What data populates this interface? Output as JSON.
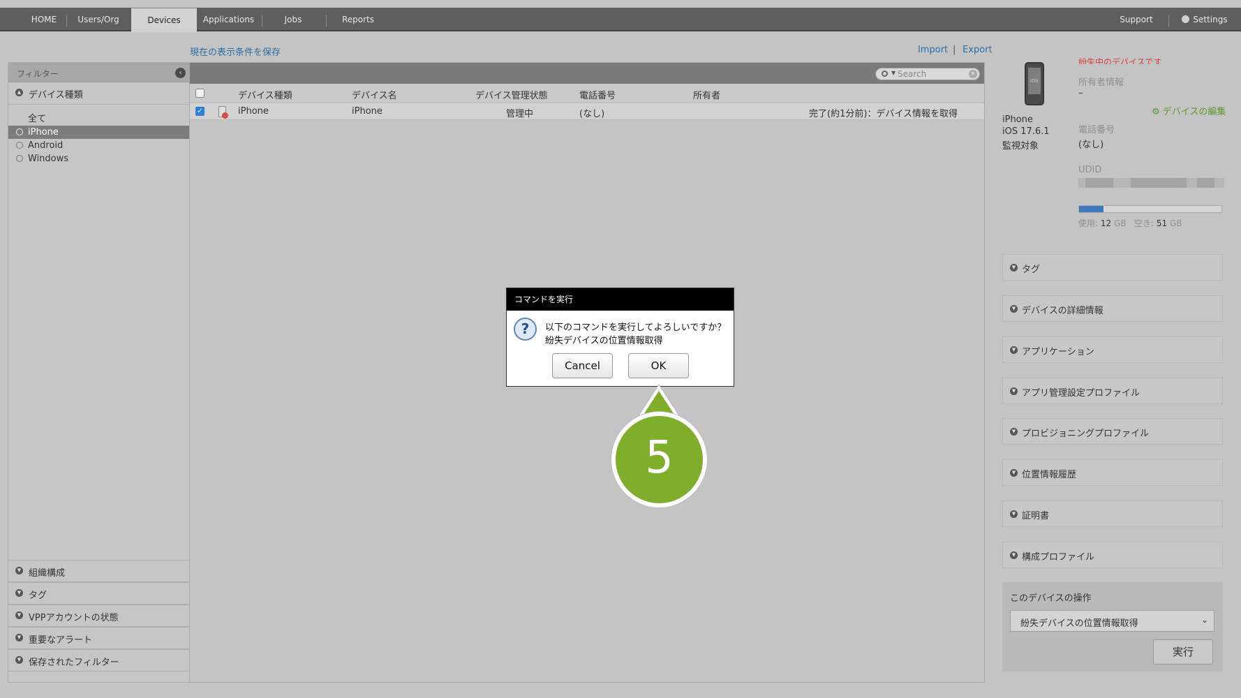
{
  "nav": {
    "tabs": [
      "HOME",
      "Users/Org",
      "Devices",
      "Applications",
      "Jobs",
      "Reports"
    ],
    "active_tab": "Devices",
    "support": "Support",
    "settings": "Settings"
  },
  "actions": {
    "save_view": "現在の表示条件を保存",
    "import": "Import",
    "separator": "|",
    "export": "Export"
  },
  "sidebar": {
    "header": "フィルター",
    "device_type_title": "デバイス種類",
    "items": [
      {
        "label": "全て",
        "selected": false
      },
      {
        "label": "iPhone",
        "selected": true
      },
      {
        "label": "Android",
        "selected": false
      },
      {
        "label": "Windows",
        "selected": false
      }
    ],
    "bottom_sections": [
      "組織構成",
      "タグ",
      "VPPアカウントの状態",
      "重要なアラート",
      "保存されたフィルター"
    ]
  },
  "table": {
    "search_placeholder": "Search",
    "columns": [
      "デバイス種類",
      "デバイス名",
      "デバイス管理状態",
      "電話番号",
      "所有者"
    ],
    "rows": [
      {
        "checked": true,
        "device_type": "iPhone",
        "device_name": "iPhone",
        "management_state": "管理中",
        "phone": "(なし)",
        "owner": "",
        "status": "完了(約1分前)：デバイス情報を取得"
      }
    ]
  },
  "detail": {
    "lost_notice": "紛失中のデバイスです",
    "owner_label": "所有者情報",
    "owner_value": "–",
    "edit_link": "デバイスの編集",
    "device_model": "iPhone",
    "os_version": "iOS 17.6.1",
    "supervised": "監視対象",
    "phone_label": "電話番号",
    "phone_value": "(なし)",
    "udid_label": "UDID",
    "storage_used_label": "使用:",
    "storage_used_value": "12",
    "storage_free_label": "空き:",
    "storage_free_value": "51",
    "storage_unit": "GB",
    "storage_used_fraction": 0.17,
    "sections": [
      "タグ",
      "デバイスの詳細情報",
      "アプリケーション",
      "アプリ管理設定プロファイル",
      "プロビジョニングプロファイル",
      "位置情報履歴",
      "証明書",
      "構成プロファイル"
    ],
    "ops_title": "このデバイスの操作",
    "ops_selected": "紛失デバイスの位置情報取得",
    "run_label": "実行"
  },
  "dialog": {
    "title": "コマンドを実行",
    "message": "以下のコマンドを実行してよろしいですか？",
    "command": "紛失デバイスの位置情報取得",
    "cancel": "Cancel",
    "ok": "OK"
  },
  "callout": {
    "step": "5",
    "color": "#7fae2a"
  },
  "colors": {
    "link": "#2a6ea5",
    "lost_red": "#d64242",
    "edit_green": "#5a9a2a",
    "nav_bg": "#5e5e5e",
    "storage_fill": "#3c79c1"
  }
}
